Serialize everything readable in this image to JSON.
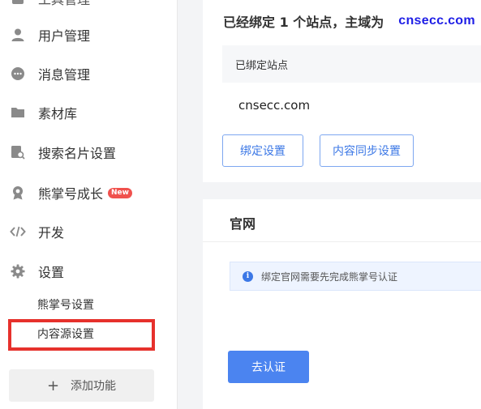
{
  "sidebar": {
    "items": [
      {
        "label": "工具管理",
        "icon": "dashboard-icon"
      },
      {
        "label": "用户管理",
        "icon": "user-icon"
      },
      {
        "label": "消息管理",
        "icon": "message-icon"
      },
      {
        "label": "素材库",
        "icon": "folder-icon"
      },
      {
        "label": "搜索名片设置",
        "icon": "search-card-icon"
      },
      {
        "label": "熊掌号成长",
        "icon": "badge-icon",
        "badge": "New"
      },
      {
        "label": "开发",
        "icon": "code-icon"
      },
      {
        "label": "设置",
        "icon": "gear-icon"
      }
    ],
    "sub_items": [
      {
        "label": "熊掌号设置"
      },
      {
        "label": "内容源设置",
        "highlighted": true
      }
    ],
    "add_button": "添加功能"
  },
  "main": {
    "bound": {
      "title": "已经绑定 1 个站点，主域为",
      "domain": "cnsecc.com",
      "table_header": "已绑定站点",
      "rows": [
        "cnsecc.com"
      ],
      "buttons": [
        "绑定设置",
        "内容同步设置"
      ]
    },
    "official": {
      "title": "官网",
      "notice": "绑定官网需要先完成熊掌号认证",
      "button": "去认证"
    }
  },
  "colors": {
    "accent": "#4b84f0",
    "highlight_border": "#e6312c",
    "domain_text": "#1e1ee6",
    "badge": "#f0514d"
  }
}
